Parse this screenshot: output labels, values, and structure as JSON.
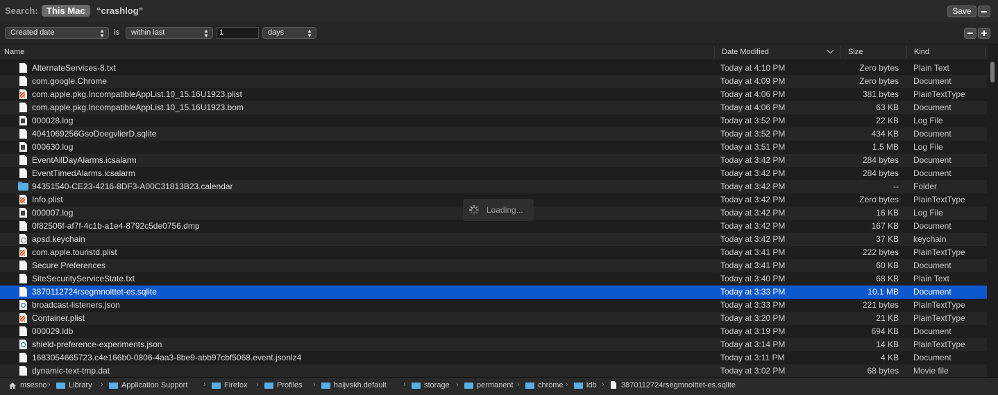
{
  "search": {
    "label": "Search:",
    "scope_active": "This Mac",
    "scope_query": "“crashlog”",
    "save_label": "Save"
  },
  "criteria": {
    "attribute": "Created date",
    "operator_label": "is",
    "condition": "within last",
    "amount": "1",
    "unit": "days"
  },
  "columns": {
    "name": "Name",
    "date": "Date Modified",
    "size": "Size",
    "kind": "Kind"
  },
  "rows": [
    {
      "icon": "doc",
      "name": "AlternateServices-8.txt",
      "date": "Today at 4:10 PM",
      "size": "Zero bytes",
      "kind": "Plain Text"
    },
    {
      "icon": "doc",
      "name": "com.google.Chrome",
      "date": "Today at 4:09 PM",
      "size": "Zero bytes",
      "kind": "Document"
    },
    {
      "icon": "plist",
      "name": "com.apple.pkg.IncompatibleAppList.10_15.16U1923.plist",
      "date": "Today at 4:06 PM",
      "size": "381 bytes",
      "kind": "PlainTextType"
    },
    {
      "icon": "doc",
      "name": "com.apple.pkg.IncompatibleAppList.10_15.16U1923.bom",
      "date": "Today at 4:06 PM",
      "size": "63 KB",
      "kind": "Document"
    },
    {
      "icon": "log",
      "name": "000028.log",
      "date": "Today at 3:52 PM",
      "size": "22 KB",
      "kind": "Log File"
    },
    {
      "icon": "doc",
      "name": "4041069256GsoDoegvlierD.sqlite",
      "date": "Today at 3:52 PM",
      "size": "434 KB",
      "kind": "Document"
    },
    {
      "icon": "log",
      "name": "000630.log",
      "date": "Today at 3:51 PM",
      "size": "1.5 MB",
      "kind": "Log File"
    },
    {
      "icon": "doc",
      "name": "EventAllDayAlarms.icsalarm",
      "date": "Today at 3:42 PM",
      "size": "284 bytes",
      "kind": "Document"
    },
    {
      "icon": "doc",
      "name": "EventTimedAlarms.icsalarm",
      "date": "Today at 3:42 PM",
      "size": "284 bytes",
      "kind": "Document"
    },
    {
      "icon": "folder",
      "name": "94351540-CE23-4216-8DF3-A00C31813B23.calendar",
      "date": "Today at 3:42 PM",
      "size": "--",
      "kind": "Folder"
    },
    {
      "icon": "plist",
      "name": "Info.plist",
      "date": "Today at 3:42 PM",
      "size": "Zero bytes",
      "kind": "PlainTextType"
    },
    {
      "icon": "log",
      "name": "000007.log",
      "date": "Today at 3:42 PM",
      "size": "16 KB",
      "kind": "Log File"
    },
    {
      "icon": "doc",
      "name": "0f82506f-af7f-4c1b-a1e4-8792c5de0756.dmp",
      "date": "Today at 3:42 PM",
      "size": "167 KB",
      "kind": "Document"
    },
    {
      "icon": "keychain",
      "name": "apsd.keychain",
      "date": "Today at 3:42 PM",
      "size": "37 KB",
      "kind": "keychain"
    },
    {
      "icon": "plist",
      "name": "com.apple.touristd.plist",
      "date": "Today at 3:41 PM",
      "size": "222 bytes",
      "kind": "PlainTextType"
    },
    {
      "icon": "doc",
      "name": "Secure Preferences",
      "date": "Today at 3:41 PM",
      "size": "60 KB",
      "kind": "Document"
    },
    {
      "icon": "doc",
      "name": "SiteSecurityServiceState.txt",
      "date": "Today at 3:40 PM",
      "size": "68 KB",
      "kind": "Plain Text"
    },
    {
      "icon": "doc",
      "name": "3870112724rsegmnoittet-es.sqlite",
      "date": "Today at 3:33 PM",
      "size": "10.1 MB",
      "kind": "Document",
      "selected": true
    },
    {
      "icon": "json",
      "name": "broadcast-listeners.json",
      "date": "Today at 3:33 PM",
      "size": "221 bytes",
      "kind": "PlainTextType"
    },
    {
      "icon": "plist",
      "name": "Container.plist",
      "date": "Today at 3:20 PM",
      "size": "21 KB",
      "kind": "PlainTextType"
    },
    {
      "icon": "doc",
      "name": "000029.ldb",
      "date": "Today at 3:19 PM",
      "size": "694 KB",
      "kind": "Document"
    },
    {
      "icon": "json",
      "name": "shield-preference-experiments.json",
      "date": "Today at 3:14 PM",
      "size": "14 KB",
      "kind": "PlainTextType"
    },
    {
      "icon": "doc",
      "name": "1683054665723.c4e166b0-0806-4aa3-8be9-abb97cbf5068.event.jsonlz4",
      "date": "Today at 3:11 PM",
      "size": "4 KB",
      "kind": "Document"
    },
    {
      "icon": "doc",
      "name": "dynamic-text-tmp.dat",
      "date": "Today at 3:02 PM",
      "size": "68 bytes",
      "kind": "Movie file"
    }
  ],
  "loading": {
    "text": "Loading..."
  },
  "path": [
    {
      "type": "home",
      "label": "msesno"
    },
    {
      "type": "folder",
      "label": "Library"
    },
    {
      "type": "folder",
      "label": "Application Support"
    },
    {
      "type": "folder",
      "label": "Firefox"
    },
    {
      "type": "folder",
      "label": "Profiles"
    },
    {
      "type": "folder",
      "label": "haijvskh.default"
    },
    {
      "type": "folder",
      "label": "storage"
    },
    {
      "type": "folder",
      "label": "permanent"
    },
    {
      "type": "folder",
      "label": "chrome"
    },
    {
      "type": "folder",
      "label": "idb"
    },
    {
      "type": "file",
      "label": "3870112724rsegmnoittet-es.sqlite"
    }
  ],
  "colors": {
    "selection": "#0b58cf",
    "folder": "#5aaee6",
    "plist_badge": "#e0632b"
  }
}
